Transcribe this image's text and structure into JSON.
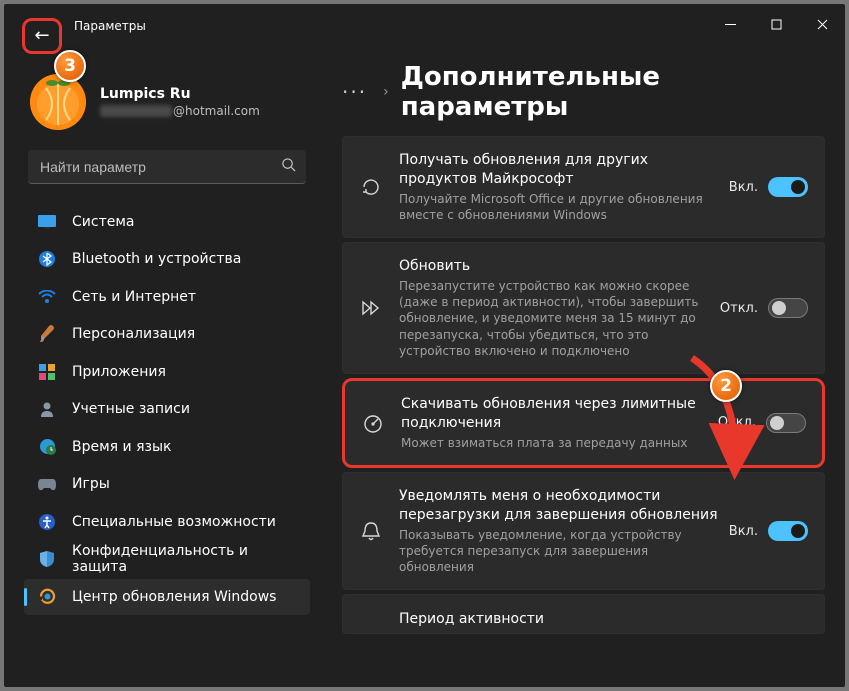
{
  "window": {
    "title": "Параметры"
  },
  "badges": {
    "b2": "2",
    "b3": "3"
  },
  "account": {
    "name": "Lumpics Ru",
    "email_domain": "@hotmail.com"
  },
  "search": {
    "placeholder": "Найти параметр"
  },
  "nav": [
    {
      "label": "Система"
    },
    {
      "label": "Bluetooth и устройства"
    },
    {
      "label": "Сеть и Интернет"
    },
    {
      "label": "Персонализация"
    },
    {
      "label": "Приложения"
    },
    {
      "label": "Учетные записи"
    },
    {
      "label": "Время и язык"
    },
    {
      "label": "Игры"
    },
    {
      "label": "Специальные возможности"
    },
    {
      "label": "Конфиденциальность и защита"
    },
    {
      "label": "Центр обновления Windows"
    }
  ],
  "breadcrumb": {
    "title": "Дополнительные параметры"
  },
  "toggle_states": {
    "on": "Вкл.",
    "off": "Откл."
  },
  "cards": [
    {
      "title": "Получать обновления для других продуктов Майкрософт",
      "desc": "Получайте Microsoft Office и другие обновления вместе с обновлениями Windows",
      "state": "on"
    },
    {
      "title": "Обновить",
      "desc": "Перезапустите устройство как можно скорее (даже в период активности), чтобы завершить обновление, и уведомите меня за 15 минут до перезапуска, чтобы убедиться, что это устройство включено и подключено",
      "state": "off"
    },
    {
      "title": "Скачивать обновления через лимитные подключения",
      "desc": "Может взиматься плата за передачу данных",
      "state": "off"
    },
    {
      "title": "Уведомлять меня о необходимости перезагрузки для завершения обновления",
      "desc": "Показывать уведомление, когда устройству требуется перезапуск для завершения обновления",
      "state": "on"
    },
    {
      "title": "Период активности",
      "desc": "",
      "state": ""
    }
  ]
}
